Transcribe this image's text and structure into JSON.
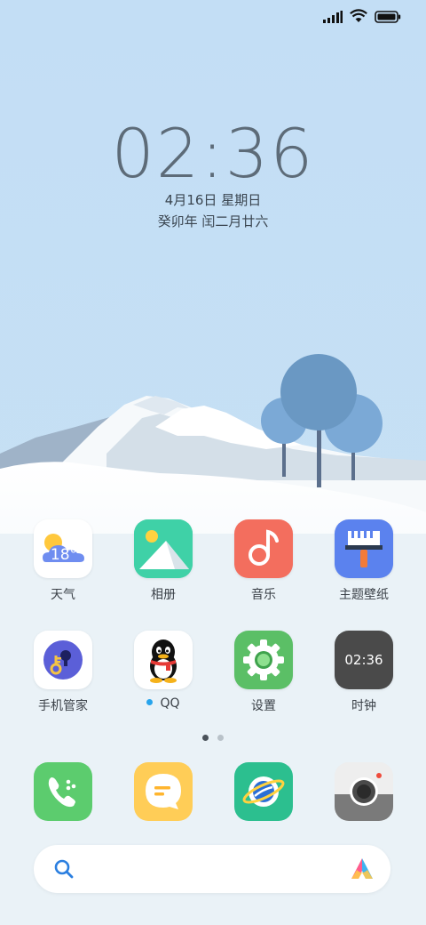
{
  "status_bar": {
    "signal_icon": "signal-bars-icon",
    "wifi_icon": "wifi-icon",
    "battery_icon": "battery-full-icon"
  },
  "lockclock": {
    "time": "02:36",
    "date": "4月16日 星期日",
    "lunar": "癸卯年 闰二月廿六"
  },
  "apps_row1": [
    {
      "label": "天气",
      "icon": "weather-icon",
      "temp": "18°"
    },
    {
      "label": "相册",
      "icon": "gallery-icon"
    },
    {
      "label": "音乐",
      "icon": "music-icon"
    },
    {
      "label": "主题壁纸",
      "icon": "themes-icon"
    }
  ],
  "apps_row2": [
    {
      "label": "手机管家",
      "icon": "security-icon"
    },
    {
      "label": "QQ",
      "icon": "qq-icon"
    },
    {
      "label": "设置",
      "icon": "settings-icon"
    },
    {
      "label": "时钟",
      "icon": "clock-icon",
      "time": "02:36"
    }
  ],
  "page_indicator": {
    "pages": 2,
    "active": 1
  },
  "dock": [
    {
      "icon": "phone-icon"
    },
    {
      "icon": "messages-icon"
    },
    {
      "icon": "browser-icon"
    },
    {
      "icon": "camera-icon"
    }
  ],
  "search": {
    "search_icon": "search-icon",
    "assistant_icon": "assistant-icon"
  },
  "colors": {
    "sky": "#c3def3",
    "phone": "#5ccc6e",
    "messages": "#ffcd57",
    "browser": "#2cbf8f",
    "music": "#f36e5e",
    "themes": "#5b82ee",
    "settings": "#5bbf66"
  }
}
